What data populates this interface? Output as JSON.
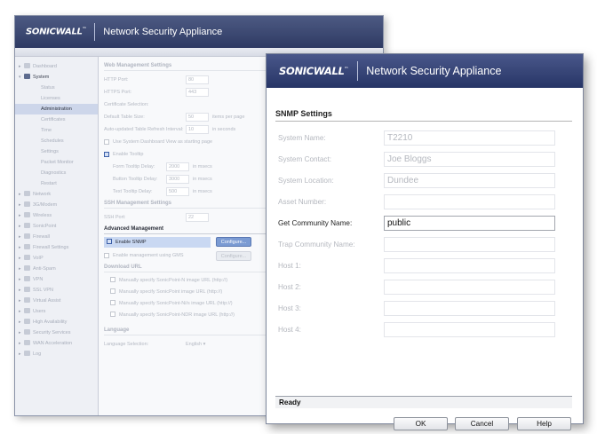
{
  "background_window": {
    "logo": "SONICWALL",
    "title": "Network Security Appliance",
    "sidebar": [
      {
        "label": "Dashboard",
        "level": 1,
        "state": "collapsed"
      },
      {
        "label": "System",
        "level": 1,
        "state": "expanded"
      },
      {
        "label": "Status",
        "level": 2
      },
      {
        "label": "Licenses",
        "level": 2
      },
      {
        "label": "Administration",
        "level": 2,
        "active": true
      },
      {
        "label": "Certificates",
        "level": 2
      },
      {
        "label": "Time",
        "level": 2
      },
      {
        "label": "Schedules",
        "level": 2
      },
      {
        "label": "Settings",
        "level": 2
      },
      {
        "label": "Packet Monitor",
        "level": 2
      },
      {
        "label": "Diagnostics",
        "level": 2
      },
      {
        "label": "Restart",
        "level": 2
      },
      {
        "label": "Network",
        "level": 1
      },
      {
        "label": "3G/Modem",
        "level": 1
      },
      {
        "label": "Wireless",
        "level": 1
      },
      {
        "label": "SonicPoint",
        "level": 1
      },
      {
        "label": "Firewall",
        "level": 1
      },
      {
        "label": "Firewall Settings",
        "level": 1
      },
      {
        "label": "VoIP",
        "level": 1
      },
      {
        "label": "Anti-Spam",
        "level": 1
      },
      {
        "label": "VPN",
        "level": 1
      },
      {
        "label": "SSL VPN",
        "level": 1
      },
      {
        "label": "Virtual Assist",
        "level": 1
      },
      {
        "label": "Users",
        "level": 1
      },
      {
        "label": "High Availability",
        "level": 1
      },
      {
        "label": "Security Services",
        "level": 1
      },
      {
        "label": "WAN Acceleration",
        "level": 1
      },
      {
        "label": "Log",
        "level": 1
      }
    ],
    "web_management": {
      "heading": "Web Management Settings",
      "http_port_label": "HTTP Port:",
      "http_port": "80",
      "https_port_label": "HTTPS Port:",
      "https_port": "443",
      "certificate_label": "Certificate Selection:",
      "table_size_label": "Default Table Size:",
      "table_size": "50",
      "table_size_suffix": "items per page",
      "refresh_label": "Auto-updated Table Refresh Interval:",
      "refresh": "10",
      "refresh_suffix": "in seconds",
      "dashboard_checkbox": "Use System Dashboard View as starting page",
      "enable_tooltip": "Enable Tooltip",
      "form_tooltip_label": "Form Tooltip Delay:",
      "form_tooltip": "2000",
      "button_tooltip_label": "Button Tooltip Delay:",
      "button_tooltip": "3000",
      "text_tooltip_label": "Text Tooltip Delay:",
      "text_tooltip": "500",
      "ms": "in msecs"
    },
    "ssh": {
      "heading": "SSH Management Settings",
      "port_label": "SSH Port:",
      "port": "22"
    },
    "advanced": {
      "heading": "Advanced Management",
      "snmp_label": "Enable SNMP",
      "snmp_button": "Configure...",
      "gms_label": "Enable management using GMS",
      "gms_button": "Configure..."
    },
    "download": {
      "heading": "Download URL",
      "items": [
        "Manually specify SonicPoint-N image URL (http://)",
        "Manually specify SonicPoint image URL (http://)",
        "Manually specify SonicPoint-Ni/s image URL (http://)",
        "Manually specify SonicPoint-NDR image URL (http://)"
      ]
    },
    "language": {
      "heading": "Language",
      "label": "Language Selection:",
      "value": "English"
    }
  },
  "dialog": {
    "logo": "SONICWALL",
    "title": "Network Security Appliance",
    "section_title": "SNMP Settings",
    "fields": [
      {
        "label": "System Name:",
        "value": "T2210",
        "enabled": false
      },
      {
        "label": "System Contact:",
        "value": "Joe Bloggs",
        "enabled": false
      },
      {
        "label": "System Location:",
        "value": "Dundee",
        "enabled": false
      },
      {
        "label": "Asset Number:",
        "value": "",
        "enabled": false
      },
      {
        "label": "Get Community Name:",
        "value": "public",
        "enabled": true
      },
      {
        "label": "Trap Community Name:",
        "value": "",
        "enabled": false
      },
      {
        "label": "Host 1:",
        "value": "",
        "enabled": false
      },
      {
        "label": "Host 2:",
        "value": "",
        "enabled": false
      },
      {
        "label": "Host 3:",
        "value": "",
        "enabled": false
      },
      {
        "label": "Host 4:",
        "value": "",
        "enabled": false
      }
    ],
    "status": "Ready",
    "buttons": {
      "ok": "OK",
      "cancel": "Cancel",
      "help": "Help"
    }
  }
}
